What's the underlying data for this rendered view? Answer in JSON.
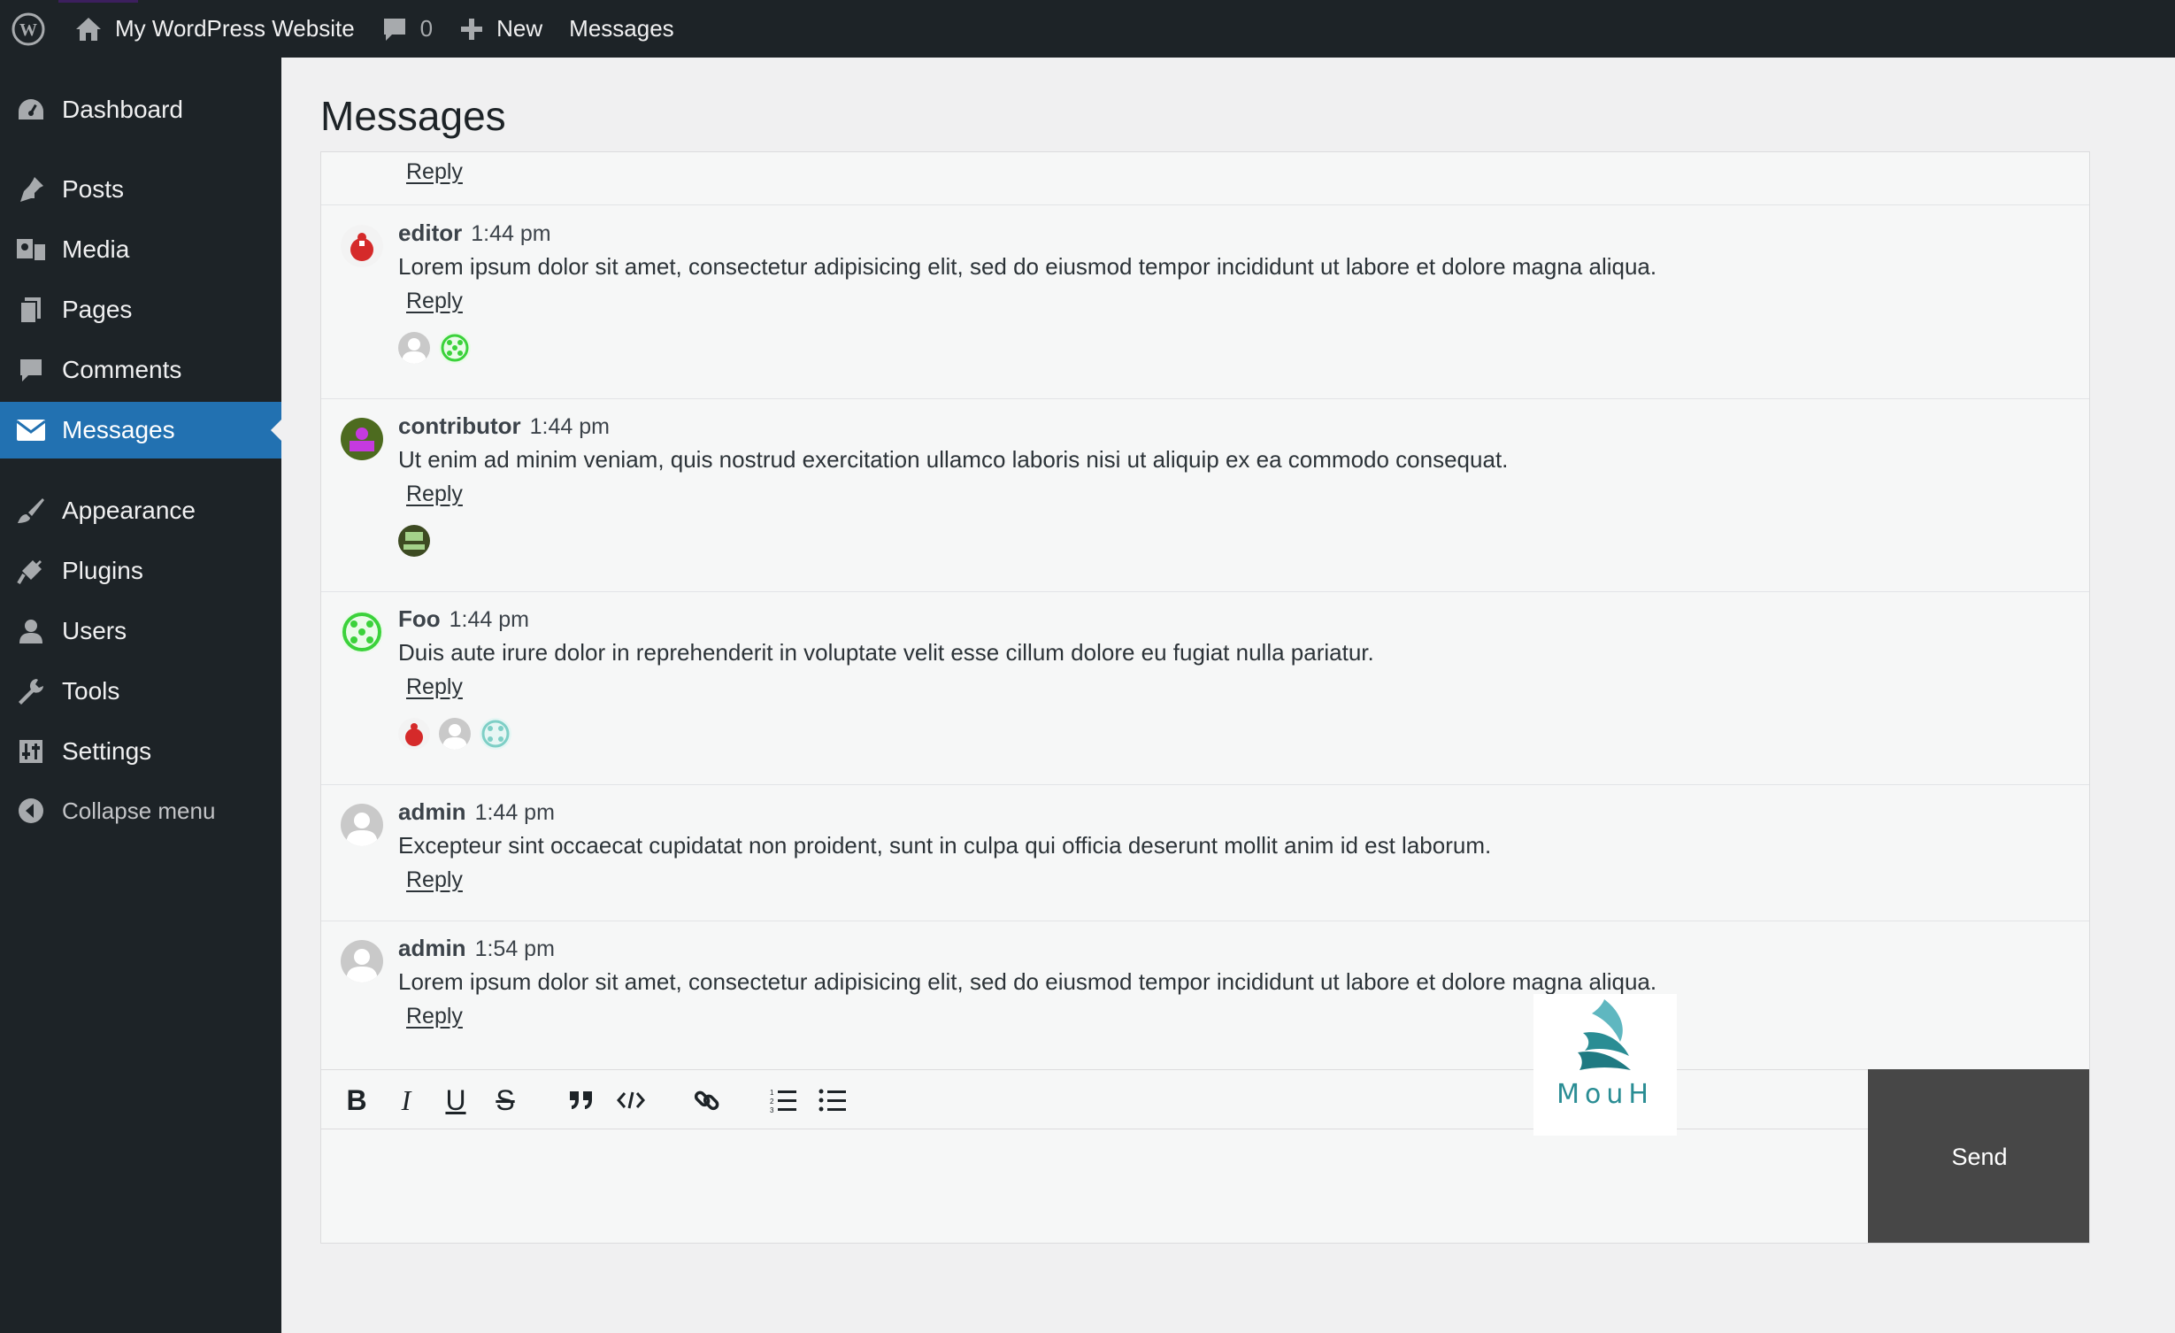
{
  "adminbar": {
    "site_name": "My WordPress Website",
    "comments_count": "0",
    "new_label": "New",
    "messages_label": "Messages"
  },
  "sidebar": {
    "items": [
      {
        "label": "Dashboard",
        "icon": "dashboard-icon"
      },
      {
        "label": "Posts",
        "icon": "pin-icon"
      },
      {
        "label": "Media",
        "icon": "media-icon"
      },
      {
        "label": "Pages",
        "icon": "pages-icon"
      },
      {
        "label": "Comments",
        "icon": "comment-icon"
      },
      {
        "label": "Messages",
        "icon": "envelope-icon",
        "active": true
      },
      {
        "label": "Appearance",
        "icon": "brush-icon"
      },
      {
        "label": "Plugins",
        "icon": "plug-icon"
      },
      {
        "label": "Users",
        "icon": "user-icon"
      },
      {
        "label": "Tools",
        "icon": "wrench-icon"
      },
      {
        "label": "Settings",
        "icon": "settings-icon"
      }
    ],
    "collapse_label": "Collapse menu"
  },
  "page": {
    "title": "Messages"
  },
  "messages": {
    "reply_label": "Reply",
    "items": [
      {
        "author": "editor",
        "time": "1:44 pm",
        "text": "Lorem ipsum dolor sit amet, consectetur adipisicing elit, sed do eiusmod tempor incididunt ut labore et dolore magna aliqua."
      },
      {
        "author": "contributor",
        "time": "1:44 pm",
        "text": "Ut enim ad minim veniam, quis nostrud exercitation ullamco laboris nisi ut aliquip ex ea commodo consequat."
      },
      {
        "author": "Foo",
        "time": "1:44 pm",
        "text": "Duis aute irure dolor in reprehenderit in voluptate velit esse cillum dolore eu fugiat nulla pariatur."
      },
      {
        "author": "admin",
        "time": "1:44 pm",
        "text": "Excepteur sint occaecat cupidatat non proident, sunt in culpa qui officia deserunt mollit anim id est laborum."
      },
      {
        "author": "admin",
        "time": "1:54 pm",
        "text": "Lorem ipsum dolor sit amet, consectetur adipisicing elit, sed do eiusmod tempor incididunt ut labore et dolore magna aliqua."
      }
    ]
  },
  "editor": {
    "toolbar": [
      "bold",
      "italic",
      "underline",
      "strikethrough",
      "quote",
      "code",
      "link",
      "ordered-list",
      "bullet-list"
    ],
    "send_label": "Send"
  },
  "logo": {
    "text": "MouH",
    "color": "#2a8d94"
  },
  "colors": {
    "accent": "#2271b1",
    "adminbar": "#1d2327",
    "send": "#474747"
  }
}
